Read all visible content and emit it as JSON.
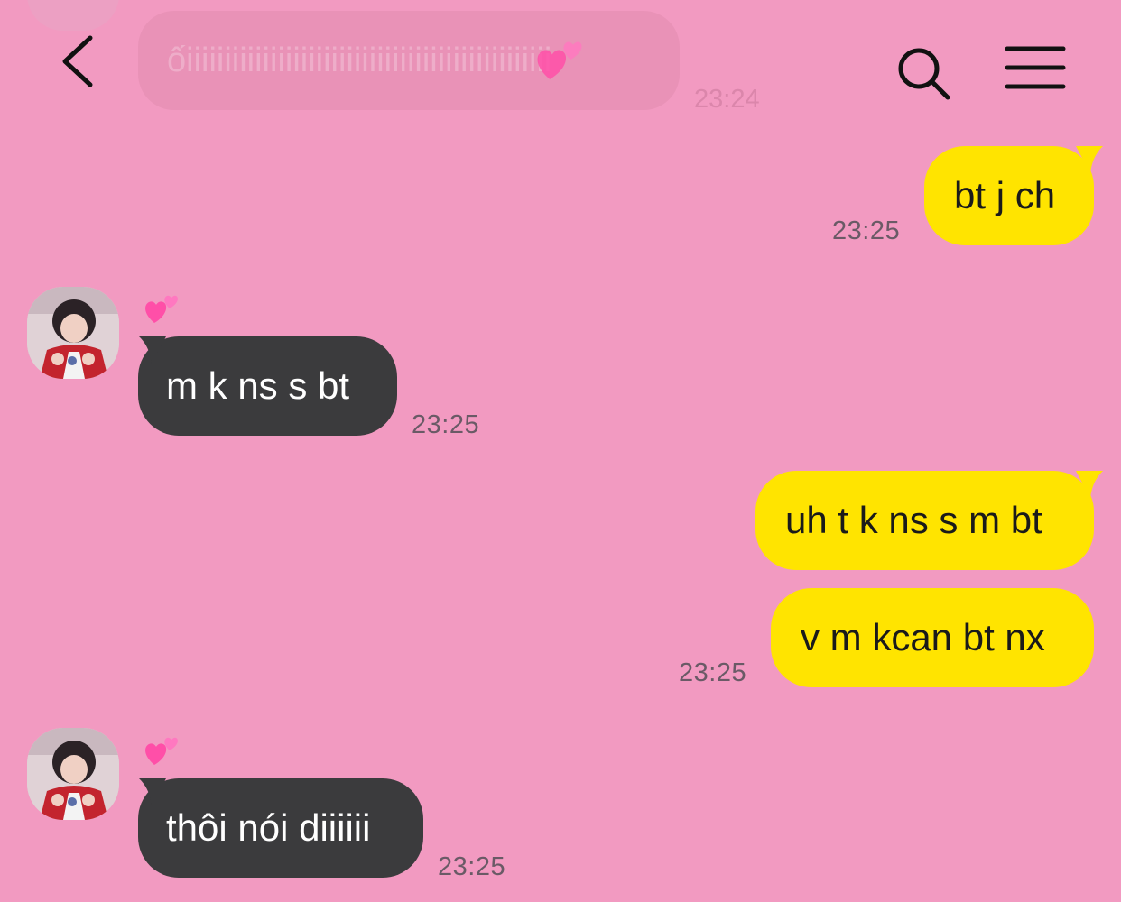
{
  "header": {
    "back_icon": "back-chevron-icon",
    "search_icon": "search-icon",
    "menu_icon": "hamburger-menu-icon"
  },
  "ghost_message": {
    "text": "ốiiiiiiiiiiiiiiiiiiiiiiiiiiiiiiiiiiiiiiiiiiiiiiii",
    "time": "23:24"
  },
  "messages": [
    {
      "side": "mine",
      "text": "bt j ch",
      "time": "23:25"
    },
    {
      "side": "theirs",
      "text": "m k ns s bt",
      "time": "23:25",
      "reaction_icon": "two-hearts-icon"
    },
    {
      "side": "mine",
      "text": "uh t k ns s m bt"
    },
    {
      "side": "mine",
      "text": "v m kcan bt nx",
      "time": "23:25"
    },
    {
      "side": "theirs",
      "text": "thôi nói diiiiii",
      "time": "23:25",
      "reaction_icon": "two-hearts-icon"
    }
  ],
  "colors": {
    "background": "#f29ac1",
    "mine_bubble": "#ffe400",
    "theirs_bubble": "#3b3b3d",
    "timestamp": "#6a5a66"
  }
}
